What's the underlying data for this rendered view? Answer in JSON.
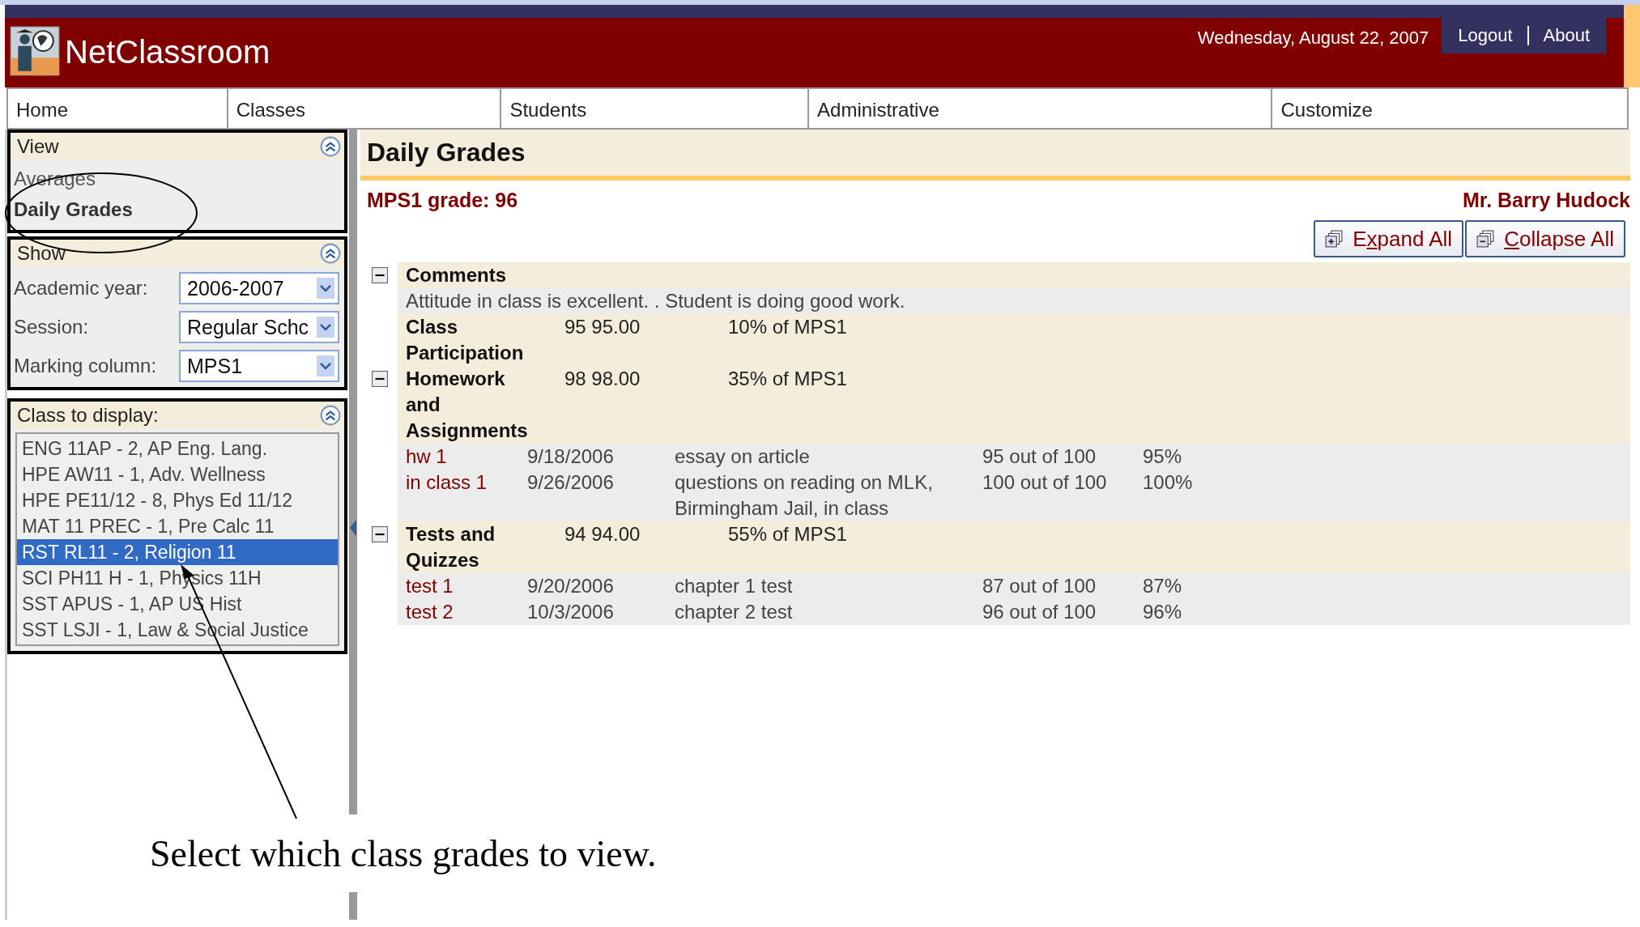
{
  "header": {
    "app_title": "NetClassroom",
    "date": "Wednesday, August 22, 2007",
    "links": [
      "Logout",
      "About"
    ]
  },
  "nav": {
    "tabs": [
      "Home",
      "Classes",
      "Students",
      "Administrative",
      "Customize"
    ]
  },
  "sidebar": {
    "view": {
      "title": "View",
      "items": [
        {
          "label": "Averages",
          "selected": false
        },
        {
          "label": "Daily Grades",
          "selected": true
        }
      ]
    },
    "show": {
      "title": "Show",
      "fields": [
        {
          "label": "Academic year:",
          "value": "2006-2007"
        },
        {
          "label": "Session:",
          "value": "Regular Schc"
        },
        {
          "label": "Marking column:",
          "value": "MPS1"
        }
      ]
    },
    "classes": {
      "title": "Class to display:",
      "items": [
        {
          "label": "ENG 11AP - 2, AP Eng. Lang.",
          "selected": false
        },
        {
          "label": "HPE AW11 - 1, Adv. Wellness",
          "selected": false
        },
        {
          "label": "HPE PE11/12 - 8, Phys Ed 11/12",
          "selected": false
        },
        {
          "label": "MAT 11 PREC - 1, Pre Calc 11",
          "selected": false
        },
        {
          "label": "RST RL11 - 2, Religion 11",
          "selected": true
        },
        {
          "label": "SCI PH11 H - 1, Physics 11H",
          "selected": false
        },
        {
          "label": "SST APUS - 1, AP US Hist",
          "selected": false
        },
        {
          "label": "SST LSJI - 1, Law & Social Justice",
          "selected": false
        }
      ]
    }
  },
  "main": {
    "title": "Daily Grades",
    "grade": "MPS1 grade: 96",
    "teacher": "Mr. Barry Hudock",
    "buttons": [
      {
        "kind": "expand",
        "before": "E",
        "key": "x",
        "after": "pand All"
      },
      {
        "kind": "collapse",
        "key": "C",
        "after": "ollapse All"
      }
    ],
    "comments": {
      "title": "Comments",
      "toggle": true,
      "text": "Attitude in class is excellent. . Student is doing good work."
    },
    "categories": [
      {
        "name": "Class Participation",
        "toggle": false,
        "score": "95 95.00",
        "weight": "10% of MPS1"
      },
      {
        "name": "Homework and Assignments",
        "toggle": true,
        "score": "98 98.00",
        "weight": "35% of MPS1",
        "items": [
          {
            "name": "hw 1",
            "date": "9/18/2006",
            "description": "essay on article",
            "points": "95 out of 100",
            "percent": "95%"
          },
          {
            "name": "in class 1",
            "date": "9/26/2006",
            "description": "questions on reading on MLK, Birmingham Jail, in class",
            "points": "100 out of 100",
            "percent": "100%"
          }
        ]
      },
      {
        "name": "Tests and Quizzes",
        "toggle": true,
        "score": "94 94.00",
        "weight": "55% of MPS1",
        "items": [
          {
            "name": "test 1",
            "date": "9/20/2006",
            "description": "chapter 1 test",
            "points": "87 out of 100",
            "percent": "87%"
          },
          {
            "name": "test 2",
            "date": "10/3/2006",
            "description": "chapter 2 test",
            "points": "96 out of 100",
            "percent": "96%"
          }
        ]
      }
    ]
  },
  "annotation": {
    "caption": "Select which class grades to view."
  }
}
